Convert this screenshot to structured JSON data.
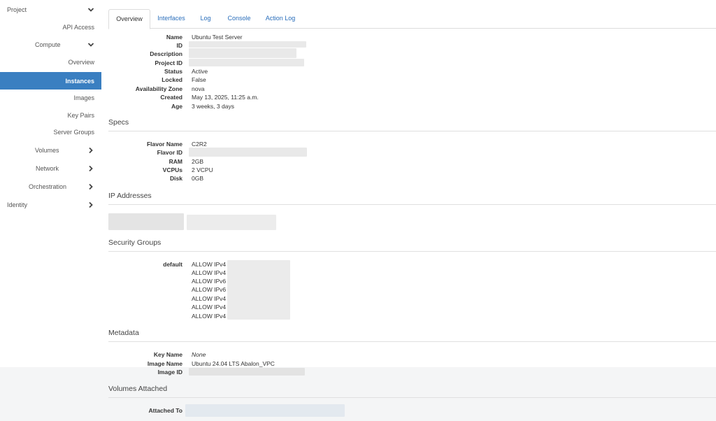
{
  "sidebar": {
    "project": "Project",
    "api_access": "API Access",
    "compute": "Compute",
    "overview": "Overview",
    "instances": "Instances",
    "images": "Images",
    "key_pairs": "Key Pairs",
    "server_groups": "Server Groups",
    "volumes": "Volumes",
    "network": "Network",
    "orchestration": "Orchestration",
    "identity": "Identity"
  },
  "tabs": {
    "overview": "Overview",
    "interfaces": "Interfaces",
    "log": "Log",
    "console": "Console",
    "action_log": "Action Log"
  },
  "overview": {
    "name_label": "Name",
    "name": "Ubuntu Test Server",
    "id_label": "ID",
    "description_label": "Description",
    "project_id_label": "Project ID",
    "status_label": "Status",
    "status": "Active",
    "locked_label": "Locked",
    "locked": "False",
    "az_label": "Availability Zone",
    "az": "nova",
    "created_label": "Created",
    "created": "May 13, 2025, 11:25 a.m.",
    "age_label": "Age",
    "age": "3 weeks, 3 days"
  },
  "specs": {
    "title": "Specs",
    "flavor_name_label": "Flavor Name",
    "flavor_name": "C2R2",
    "flavor_id_label": "Flavor ID",
    "ram_label": "RAM",
    "ram": "2GB",
    "vcpus_label": "VCPUs",
    "vcpus": "2 VCPU",
    "disk_label": "Disk",
    "disk": "0GB"
  },
  "ip": {
    "title": "IP Addresses"
  },
  "security": {
    "title": "Security Groups",
    "group_label": "default",
    "rules": [
      "ALLOW IPv4",
      "ALLOW IPv4",
      "ALLOW IPv6",
      "ALLOW IPv6",
      "ALLOW IPv4",
      "ALLOW IPv4",
      "ALLOW IPv4"
    ]
  },
  "metadata": {
    "title": "Metadata",
    "key_name_label": "Key Name",
    "key_name": "None",
    "image_name_label": "Image Name",
    "image_name": "Ubuntu 24.04 LTS Abalon_VPC",
    "image_id_label": "Image ID"
  },
  "volumes": {
    "title": "Volumes Attached",
    "attached_label": "Attached To"
  }
}
